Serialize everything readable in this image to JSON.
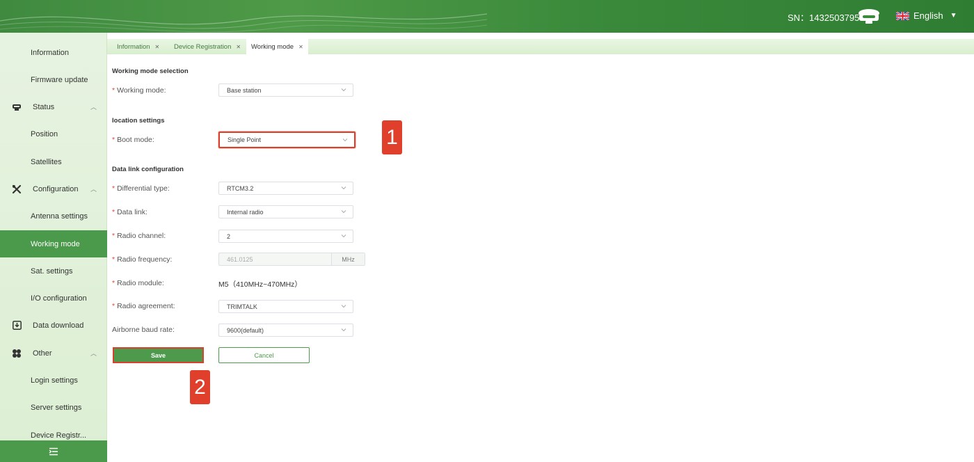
{
  "header": {
    "sn_label": "SN：1432503795",
    "language": "English"
  },
  "sidebar": {
    "items": [
      {
        "label": "Information"
      },
      {
        "label": "Firmware update"
      },
      {
        "label": "Status"
      },
      {
        "label": "Position"
      },
      {
        "label": "Satellites"
      },
      {
        "label": "Configuration"
      },
      {
        "label": "Antenna settings"
      },
      {
        "label": "Working mode"
      },
      {
        "label": "Sat. settings"
      },
      {
        "label": "I/O configuration"
      },
      {
        "label": "Data download"
      },
      {
        "label": "Other"
      },
      {
        "label": "Login settings"
      },
      {
        "label": "Server settings"
      },
      {
        "label": "Device Registr..."
      }
    ],
    "icons": [
      "status-icon",
      "wrench-icon",
      "download-icon",
      "grid-icon",
      "menu-icon"
    ]
  },
  "tabs": [
    {
      "label": "Information"
    },
    {
      "label": "Device Registration"
    },
    {
      "label": "Working mode"
    }
  ],
  "form": {
    "section_mode": "Working mode selection",
    "working_mode_label": "Working mode:",
    "working_mode_value": "Base station",
    "section_location": "location settings",
    "boot_mode_label": "Boot mode:",
    "boot_mode_value": "Single Point",
    "section_datalink": "Data link configuration",
    "diff_type_label": "Differential type:",
    "diff_type_value": "RTCM3.2",
    "data_link_label": "Data link:",
    "data_link_value": "Internal radio",
    "radio_channel_label": "Radio channel:",
    "radio_channel_value": "2",
    "radio_freq_label": "Radio frequency:",
    "radio_freq_value": "461.0125",
    "radio_freq_unit": "MHz",
    "radio_module_label": "Radio module:",
    "radio_module_value": "M5（410MHz~470MHz）",
    "radio_agreement_label": "Radio agreement:",
    "radio_agreement_value": "TRIMTALK",
    "baud_label": "Airborne baud rate:",
    "baud_value": "9600(default)",
    "save_label": "Save",
    "cancel_label": "Cancel",
    "required_mark": "*"
  },
  "callouts": {
    "one": "1",
    "two": "2"
  },
  "colors": {
    "brand_green": "#4b9a4b",
    "highlight_red": "#d9412f",
    "required_red": "#e0483e"
  }
}
